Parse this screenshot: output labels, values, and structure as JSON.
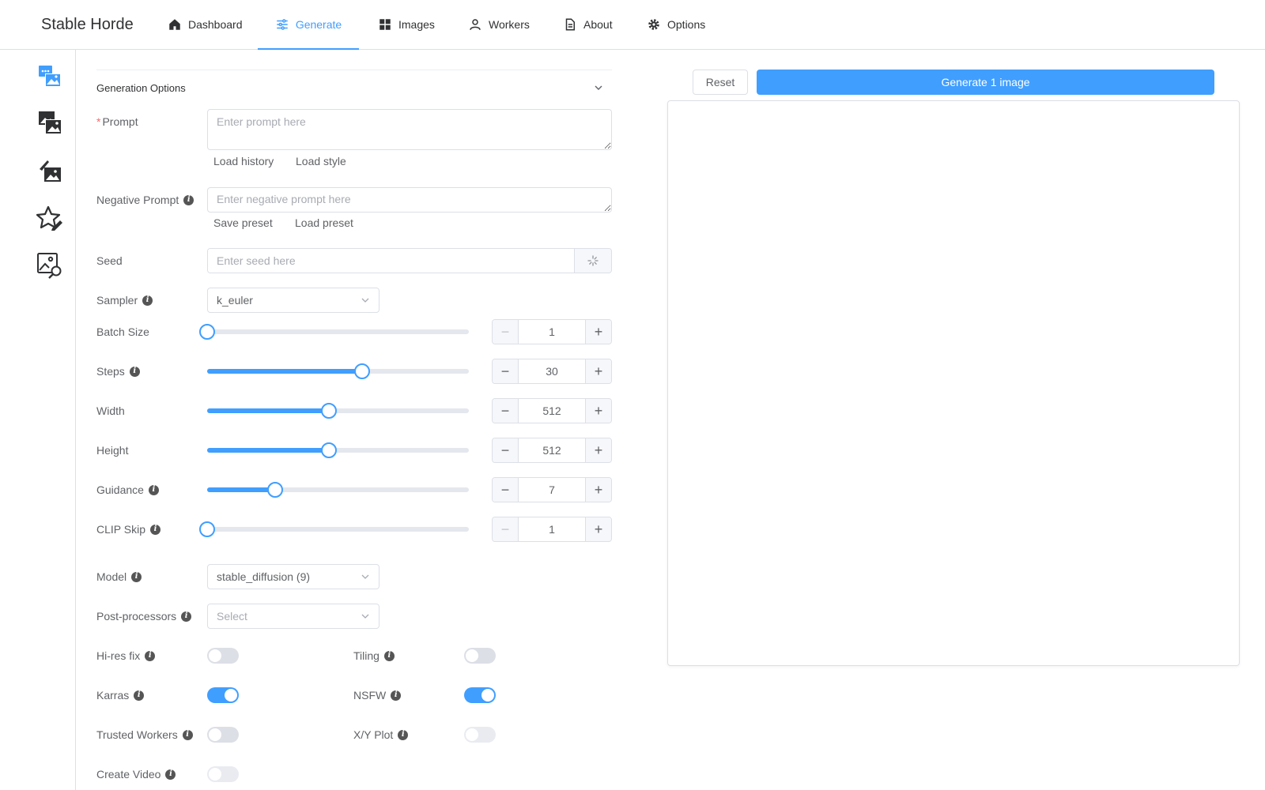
{
  "header": {
    "brand": "Stable Horde",
    "nav": [
      {
        "label": "Dashboard",
        "icon": "home-icon"
      },
      {
        "label": "Generate",
        "icon": "sliders-icon",
        "active": true
      },
      {
        "label": "Images",
        "icon": "grid-icon"
      },
      {
        "label": "Workers",
        "icon": "user-icon"
      },
      {
        "label": "About",
        "icon": "document-icon"
      },
      {
        "label": "Options",
        "icon": "gear-icon"
      }
    ]
  },
  "sidebar": {
    "items": [
      {
        "name": "text-to-image",
        "icon": "text-to-image-icon",
        "active": true
      },
      {
        "name": "image-to-image",
        "icon": "image-to-image-icon"
      },
      {
        "name": "inpainting",
        "icon": "inpainting-icon"
      },
      {
        "name": "rating",
        "icon": "star-edit-icon"
      },
      {
        "name": "interrogation",
        "icon": "image-search-icon"
      }
    ]
  },
  "form": {
    "section_title": "Generation Options",
    "prompt": {
      "label": "Prompt",
      "required_mark": "*",
      "placeholder": "Enter prompt here",
      "value": "",
      "load_history": "Load history",
      "load_style": "Load style"
    },
    "negative_prompt": {
      "label": "Negative Prompt",
      "placeholder": "Enter negative prompt here",
      "value": "",
      "save_preset": "Save preset",
      "load_preset": "Load preset"
    },
    "seed": {
      "label": "Seed",
      "placeholder": "Enter seed here",
      "value": ""
    },
    "sampler": {
      "label": "Sampler",
      "value": "k_euler"
    },
    "sliders": [
      {
        "key": "batch_size",
        "label": "Batch Size",
        "value": "1",
        "min": 1,
        "max": 20,
        "info": false,
        "minus_disabled": true
      },
      {
        "key": "steps",
        "label": "Steps",
        "value": "30",
        "min": 1,
        "max": 50,
        "info": true,
        "minus_disabled": false
      },
      {
        "key": "width",
        "label": "Width",
        "value": "512",
        "min": 64,
        "max": 1024,
        "info": false,
        "minus_disabled": false
      },
      {
        "key": "height",
        "label": "Height",
        "value": "512",
        "min": 64,
        "max": 1024,
        "info": false,
        "minus_disabled": false
      },
      {
        "key": "guidance",
        "label": "Guidance",
        "value": "7",
        "min": 1,
        "max": 24,
        "info": true,
        "minus_disabled": false
      },
      {
        "key": "clip_skip",
        "label": "CLIP Skip",
        "value": "1",
        "min": 1,
        "max": 10,
        "info": true,
        "minus_disabled": true
      }
    ],
    "model": {
      "label": "Model",
      "value": "stable_diffusion (9)"
    },
    "post_processors": {
      "label": "Post-processors",
      "placeholder": "Select"
    },
    "switches": [
      {
        "label": "Hi-res fix",
        "on": false,
        "faded": false
      },
      {
        "label": "Tiling",
        "on": false,
        "faded": false
      },
      {
        "label": "Karras",
        "on": true,
        "faded": false
      },
      {
        "label": "NSFW",
        "on": true,
        "faded": false
      },
      {
        "label": "Trusted Workers",
        "on": false,
        "faded": false
      },
      {
        "label": "X/Y Plot",
        "on": false,
        "faded": true
      },
      {
        "label": "Create Video",
        "on": false,
        "faded": true
      }
    ]
  },
  "actions": {
    "reset": "Reset",
    "generate": "Generate 1 image"
  },
  "colors": {
    "accent": "#409eff",
    "border": "#dcdfe6",
    "required": "#f56c6c"
  }
}
